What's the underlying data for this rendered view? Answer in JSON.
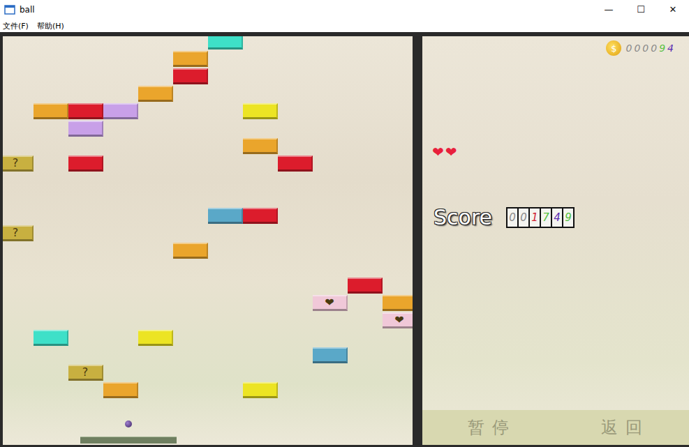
{
  "window": {
    "title": "ball",
    "controls": [
      "—",
      "☐",
      "✕"
    ]
  },
  "menu": [
    "文件(F)",
    "帮助(H)"
  ],
  "bricks": [
    {
      "row": 0,
      "col": 6,
      "color": "#3ee0c8"
    },
    {
      "row": 1,
      "col": 5,
      "color": "#eaa52c"
    },
    {
      "row": 2,
      "col": 5,
      "color": "#dc1c2c"
    },
    {
      "row": 3,
      "col": 4,
      "color": "#eaa52c"
    },
    {
      "row": 4,
      "col": 1,
      "color": "#eaa52c"
    },
    {
      "row": 4,
      "col": 2,
      "color": "#dc1c2c"
    },
    {
      "row": 4,
      "col": 3,
      "color": "#c8a0e8"
    },
    {
      "row": 4,
      "col": 7,
      "color": "#ece424"
    },
    {
      "row": 5,
      "col": 2,
      "color": "#c8a0e8"
    },
    {
      "row": 6,
      "col": 7,
      "color": "#eaa52c"
    },
    {
      "row": 7,
      "col": 0,
      "color": "#c8b040",
      "label": "?"
    },
    {
      "row": 7,
      "col": 2,
      "color": "#dc1c2c"
    },
    {
      "row": 7,
      "col": 8,
      "color": "#dc1c2c"
    },
    {
      "row": 10,
      "col": 6,
      "color": "#5aa8c8"
    },
    {
      "row": 10,
      "col": 7,
      "color": "#dc1c2c"
    },
    {
      "row": 11,
      "col": 0,
      "color": "#c8b040",
      "label": "?"
    },
    {
      "row": 12,
      "col": 5,
      "color": "#eaa52c"
    },
    {
      "row": 14,
      "col": 10,
      "color": "#dc1c2c"
    },
    {
      "row": 15,
      "col": 9,
      "color": "#f0c8d8",
      "label": "❤"
    },
    {
      "row": 15,
      "col": 11,
      "color": "#eaa52c"
    },
    {
      "row": 16,
      "col": 11,
      "color": "#f0c8d8",
      "label": "❤"
    },
    {
      "row": 17,
      "col": 1,
      "color": "#3ee0c8"
    },
    {
      "row": 17,
      "col": 4,
      "color": "#ece424"
    },
    {
      "row": 18,
      "col": 9,
      "color": "#5aa8c8"
    },
    {
      "row": 19,
      "col": 2,
      "color": "#c8b040",
      "label": "?"
    },
    {
      "row": 20,
      "col": 3,
      "color": "#eaa52c"
    },
    {
      "row": 20,
      "col": 7,
      "color": "#ece424"
    }
  ],
  "coins": {
    "icon": "$",
    "digits": [
      {
        "text": "0",
        "color": "#8a8a8a"
      },
      {
        "text": "0",
        "color": "#8a8a8a"
      },
      {
        "text": "0",
        "color": "#8a8a8a"
      },
      {
        "text": "0",
        "color": "#8a8a8a"
      },
      {
        "text": "9",
        "color": "#55c040"
      },
      {
        "text": "4",
        "color": "#5a2ab0"
      }
    ]
  },
  "lives": [
    "❤",
    "❤"
  ],
  "score": {
    "label": "Score",
    "digits": [
      {
        "text": "0",
        "color": "#8a8a8a"
      },
      {
        "text": "0",
        "color": "#8a8a8a"
      },
      {
        "text": "1",
        "color": "#d02030"
      },
      {
        "text": "7",
        "color": "#55c040"
      },
      {
        "text": "4",
        "color": "#5a2ab0"
      },
      {
        "text": "9",
        "color": "#55c040"
      }
    ]
  },
  "buttons": [
    "暂 停",
    "返 回"
  ]
}
